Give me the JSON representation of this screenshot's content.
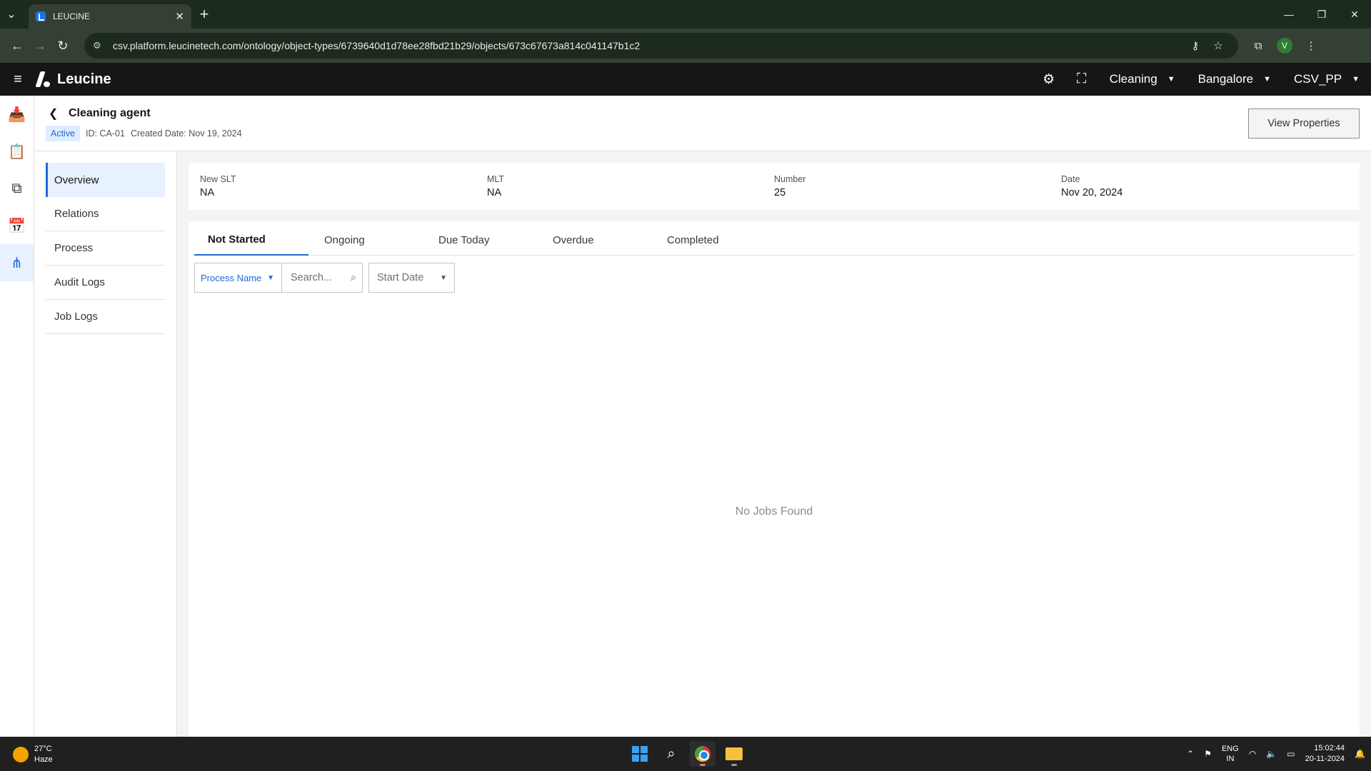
{
  "browser": {
    "tab_title": "LEUCINE",
    "url": "csv.platform.leucinetech.com/ontology/object-types/6739640d1d78ee28fbd21b29/objects/673c67673a814c041147b1c2",
    "profile_initial": "V"
  },
  "app": {
    "brand": "Leucine",
    "dropdowns": [
      "Cleaning",
      "Bangalore",
      "CSV_PP"
    ]
  },
  "page": {
    "title": "Cleaning agent",
    "status": "Active",
    "id_text": "ID: CA-01",
    "created_text": "Created Date: Nov 19, 2024",
    "view_properties_label": "View Properties"
  },
  "subnav": {
    "items": [
      {
        "label": "Overview",
        "active": true
      },
      {
        "label": "Relations"
      },
      {
        "label": "Process"
      },
      {
        "label": "Audit Logs"
      },
      {
        "label": "Job Logs"
      }
    ]
  },
  "properties": [
    {
      "label": "New SLT",
      "value": "NA"
    },
    {
      "label": "MLT",
      "value": "NA"
    },
    {
      "label": "Number",
      "value": "25"
    },
    {
      "label": "Date",
      "value": "Nov 20, 2024"
    }
  ],
  "jobs": {
    "tabs": [
      "Not Started",
      "Ongoing",
      "Due Today",
      "Overdue",
      "Completed"
    ],
    "active_tab": "Not Started",
    "filter_process_label": "Process Name",
    "search_placeholder": "Search...",
    "start_date_label": "Start Date",
    "empty_message": "No Jobs Found"
  },
  "taskbar": {
    "temperature": "27°C",
    "weather": "Haze",
    "lang_1": "ENG",
    "lang_2": "IN",
    "time": "15:02:44",
    "date": "20-11-2024"
  },
  "colors": {
    "accent": "#1d6bd6",
    "appbar": "#161616",
    "badge_bg": "#e0ecff"
  }
}
